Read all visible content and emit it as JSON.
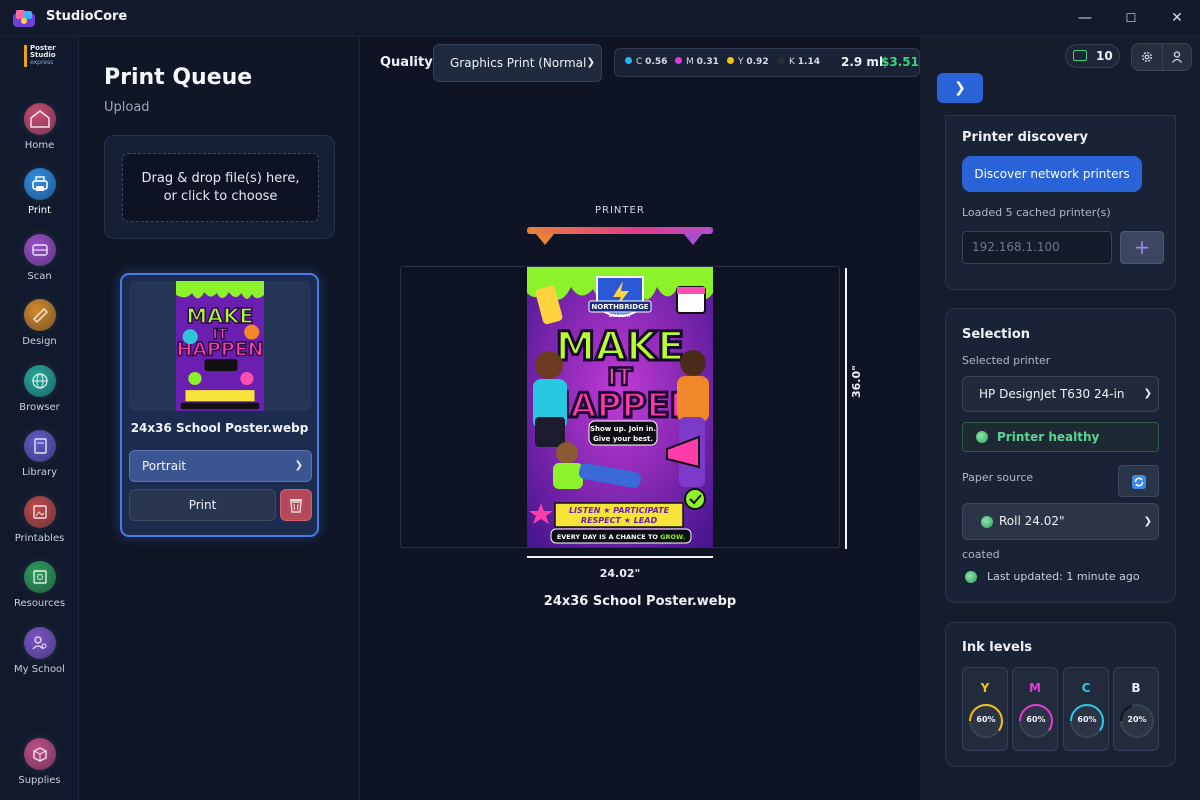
{
  "app": {
    "title": "StudioCore"
  },
  "window": {
    "minimize": "—",
    "maximize": "☐",
    "close": "✕"
  },
  "brand": {
    "line1": "Poster",
    "line2": "Studio",
    "line3": "express"
  },
  "nav": [
    {
      "label": "Home",
      "icon": "home-icon",
      "color": "#c84d72"
    },
    {
      "label": "Print",
      "icon": "printer-icon",
      "color": "#2e8fe6"
    },
    {
      "label": "Scan",
      "icon": "scan-icon",
      "color": "#9a4fc7"
    },
    {
      "label": "Design",
      "icon": "palette-icon",
      "color": "#d28a2a"
    },
    {
      "label": "Browser",
      "icon": "globe-icon",
      "color": "#27a89a"
    },
    {
      "label": "Library",
      "icon": "book-icon",
      "color": "#5e5cc9"
    },
    {
      "label": "Printables",
      "icon": "printables-icon",
      "color": "#c04a4a"
    },
    {
      "label": "Resources",
      "icon": "resources-icon",
      "color": "#2f9d5a"
    },
    {
      "label": "My School",
      "icon": "school-icon",
      "color": "#7d55c8"
    },
    {
      "label": "Supplies",
      "icon": "box-icon",
      "color": "#c44e86"
    }
  ],
  "queue": {
    "title": "Print Queue",
    "upload_label": "Upload",
    "drop_line1": "Drag & drop file(s) here,",
    "drop_line2": "or click to choose",
    "item": {
      "filename": "24x36 School Poster.webp",
      "orientation": "Portrait",
      "print_label": "Print"
    }
  },
  "toolbar": {
    "quality_label": "Quality:",
    "quality_value": "Graphics Print (Normal",
    "ink": {
      "c_label": "C",
      "c_value": "0.56",
      "m_label": "M",
      "m_value": "0.31",
      "y_label": "Y",
      "y_value": "0.92",
      "k_label": "K",
      "k_value": "1.14",
      "total_ml": "2.9 ml",
      "cost": "$3.51"
    }
  },
  "preview": {
    "printer_label": "PRINTER",
    "height_label": "36.0\"",
    "width_label": "24.02\"",
    "filename": "24x36 School Poster.webp",
    "poster": {
      "badge": "NORTHBRIDGE",
      "badge_sub": "ACADEMY",
      "line1": "MAKE",
      "line2": "IT",
      "line3": "HAPPEN",
      "bubble1": "Show up. Join in.",
      "bubble2": "Give your best.",
      "banner1": "LISTEN ★ PARTICIPATE",
      "banner2": "RESPECT ★ LEAD",
      "footer_a": "EVERY DAY IS A CHANCE TO ",
      "footer_b": "GROW."
    }
  },
  "right": {
    "credits": "10",
    "discovery": {
      "title": "Printer discovery",
      "button": "Discover network printers",
      "cached": "Loaded 5 cached printer(s)",
      "ip_placeholder": "192.168.1.100",
      "add": "+"
    },
    "selection": {
      "title": "Selection",
      "printer_label": "Selected printer",
      "printer_value": "HP DesignJet T630 24-in",
      "status": "Printer healthy",
      "paper_label": "Paper source",
      "paper_value": "Roll 24.02\"",
      "paper_type": "coated",
      "updated": "Last updated: 1 minute ago"
    },
    "ink": {
      "title": "Ink levels",
      "levels": [
        {
          "letter": "Y",
          "pct": "60%",
          "value": 60,
          "color": "#f2c21a"
        },
        {
          "letter": "M",
          "pct": "60%",
          "value": 60,
          "color": "#e23ad4"
        },
        {
          "letter": "C",
          "pct": "60%",
          "value": 60,
          "color": "#27c9e0"
        },
        {
          "letter": "B",
          "pct": "20%",
          "value": 20,
          "color": "#111111"
        }
      ]
    }
  }
}
